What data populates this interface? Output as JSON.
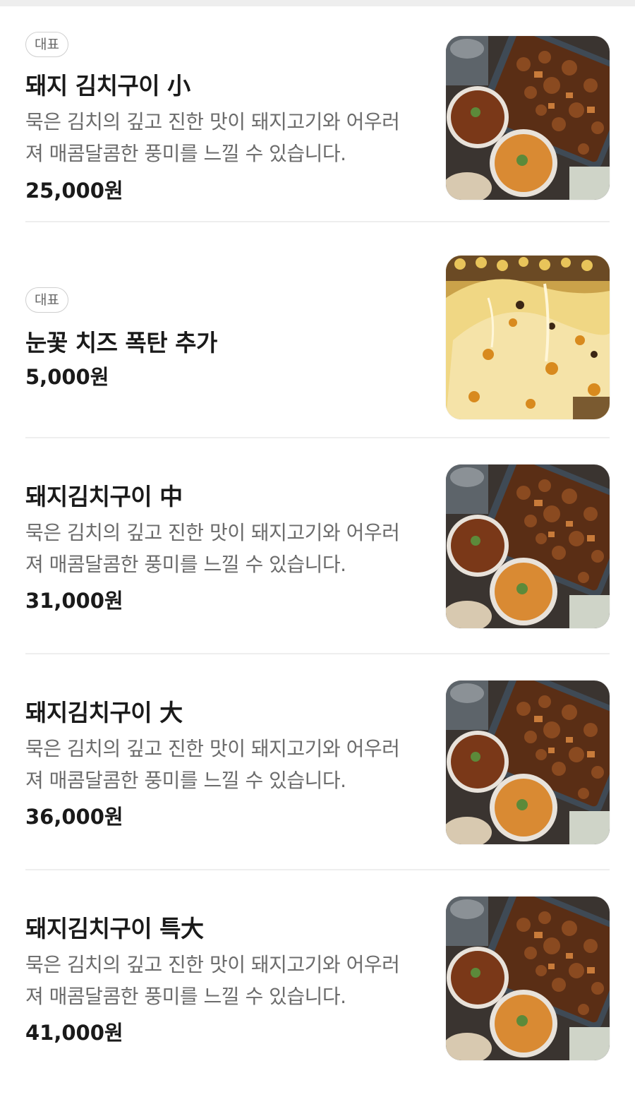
{
  "items": [
    {
      "badge": "대표",
      "name": "돼지 김치구이 小",
      "description": "묵은 김치의 깊고 진한 맛이 돼지고기와 어우러져 매콤달콤한 풍미를 느낄 수 있습니다.",
      "price": "25,000원",
      "image": "kimchi-pork-photo"
    },
    {
      "badge": "대표",
      "name": "눈꽃 치즈 폭탄 추가",
      "description": "",
      "price": "5,000원",
      "image": "cheese-photo"
    },
    {
      "badge": "",
      "name": "돼지김치구이 中",
      "description": "묵은 김치의 깊고 진한 맛이 돼지고기와 어우러져 매콤달콤한 풍미를 느낄 수 있습니다.",
      "price": "31,000원",
      "image": "kimchi-pork-photo"
    },
    {
      "badge": "",
      "name": "돼지김치구이 大",
      "description": "묵은 김치의 깊고 진한 맛이 돼지고기와 어우러져 매콤달콤한 풍미를 느낄 수 있습니다.",
      "price": "36,000원",
      "image": "kimchi-pork-photo"
    },
    {
      "badge": "",
      "name": "돼지김치구이 특大",
      "description": "묵은 김치의 깊고 진한 맛이 돼지고기와 어우러져 매콤달콤한 풍미를 느낄 수 있습니다.",
      "price": "41,000원",
      "image": "kimchi-pork-photo"
    }
  ]
}
